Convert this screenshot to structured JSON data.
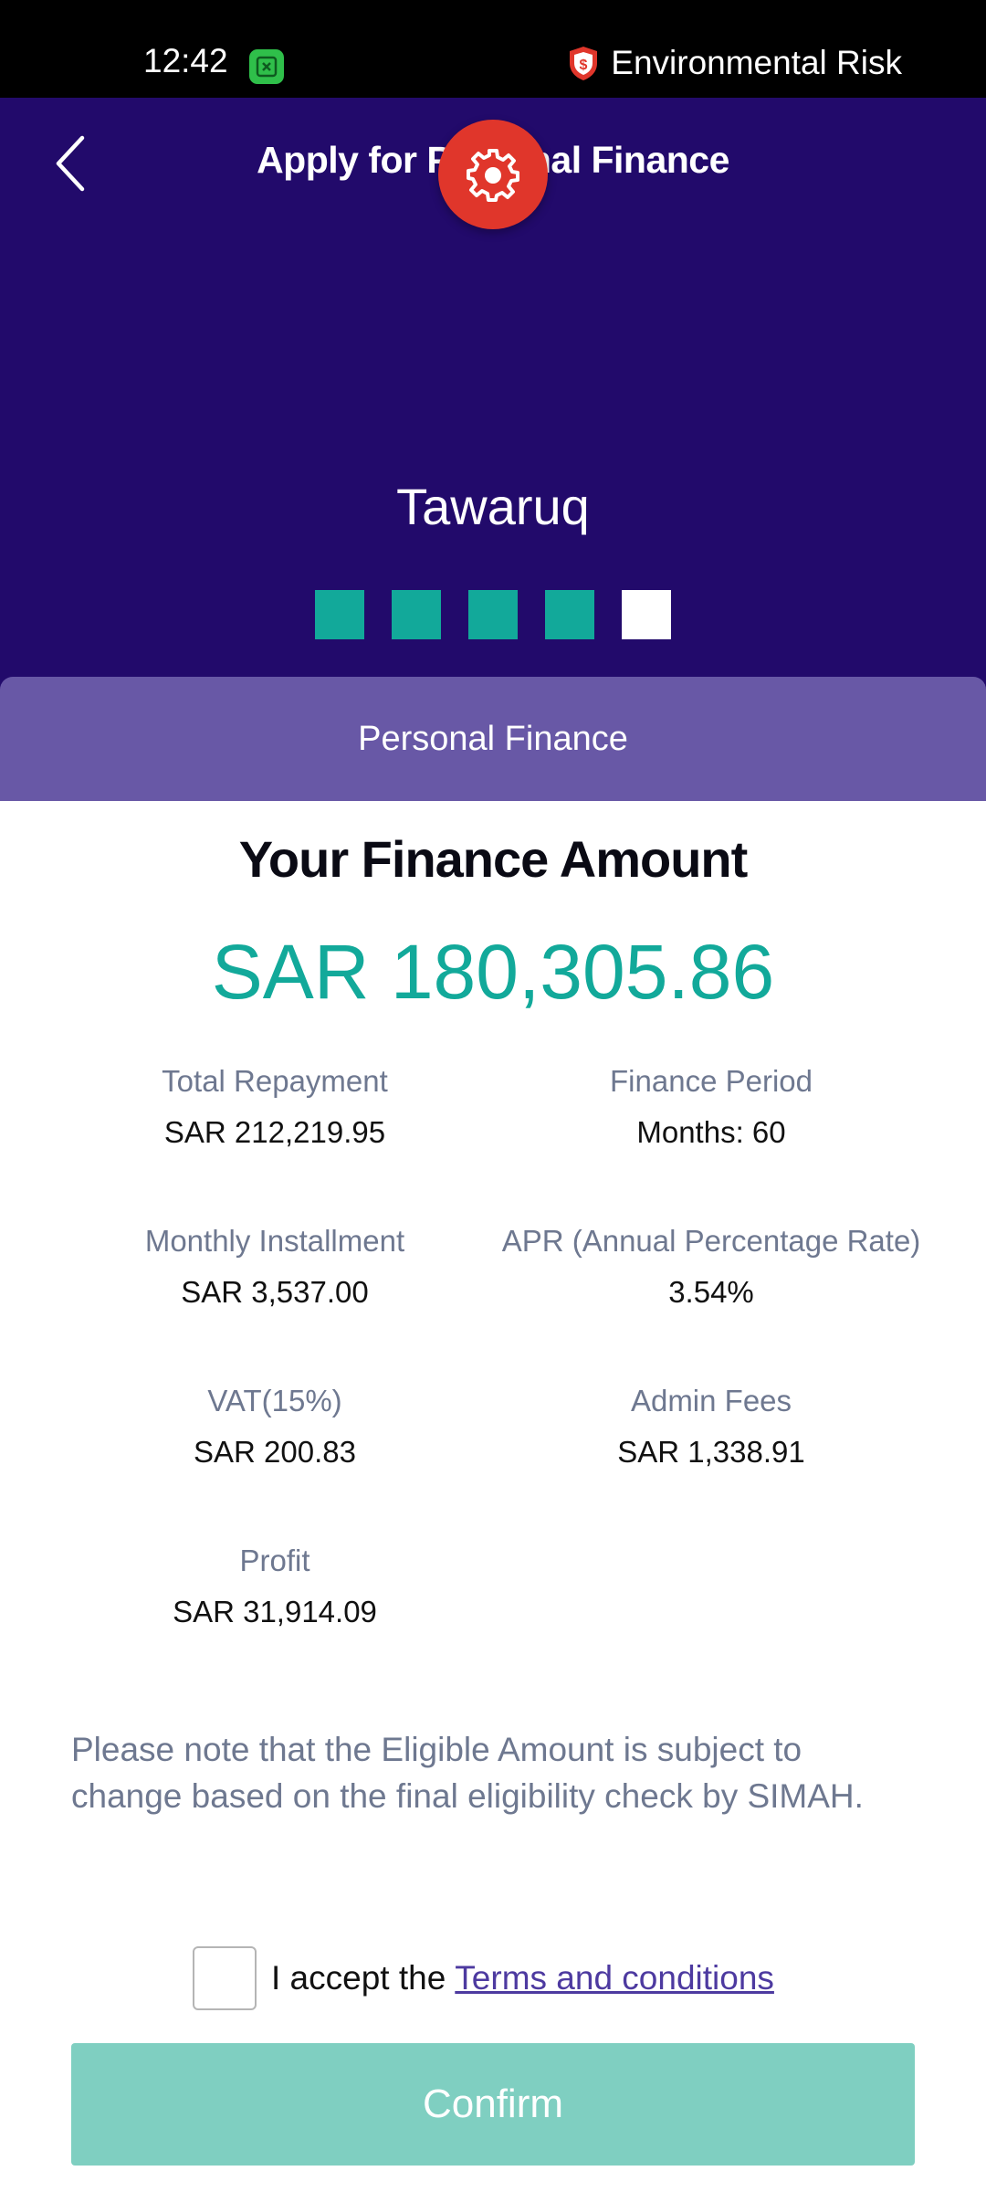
{
  "status_bar": {
    "time": "12:42",
    "risk_label": "Environmental Risk"
  },
  "header": {
    "title": "Apply for Personal Finance",
    "product_name": "Tawaruq",
    "steps_total": 5,
    "steps_completed": 4
  },
  "section": {
    "label": "Personal Finance"
  },
  "summary": {
    "title": "Your Finance Amount",
    "amount": "SAR 180,305.86"
  },
  "details": [
    {
      "label": "Total Repayment",
      "value": "SAR 212,219.95"
    },
    {
      "label": "Finance Period",
      "value": "Months: 60"
    },
    {
      "label": "Monthly Installment",
      "value": "SAR 3,537.00"
    },
    {
      "label": "APR (Annual Percentage Rate)",
      "value": "3.54%"
    },
    {
      "label": "VAT(15%)",
      "value": "SAR 200.83"
    },
    {
      "label": "Admin Fees",
      "value": "SAR 1,338.91"
    },
    {
      "label": "Profit",
      "value": "SAR 31,914.09"
    }
  ],
  "note": "Please note that the Eligible Amount is subject to change based on the final eligibility check by SIMAH.",
  "accept": {
    "prefix": "I accept the",
    "link": "Terms and conditions",
    "checked": false
  },
  "confirm_label": "Confirm",
  "colors": {
    "header_bg": "#220a6b",
    "section_bg": "#6858a6",
    "accent": "#12a99a",
    "fab": "#e0362b",
    "confirm_disabled": "#7fcfc1"
  }
}
